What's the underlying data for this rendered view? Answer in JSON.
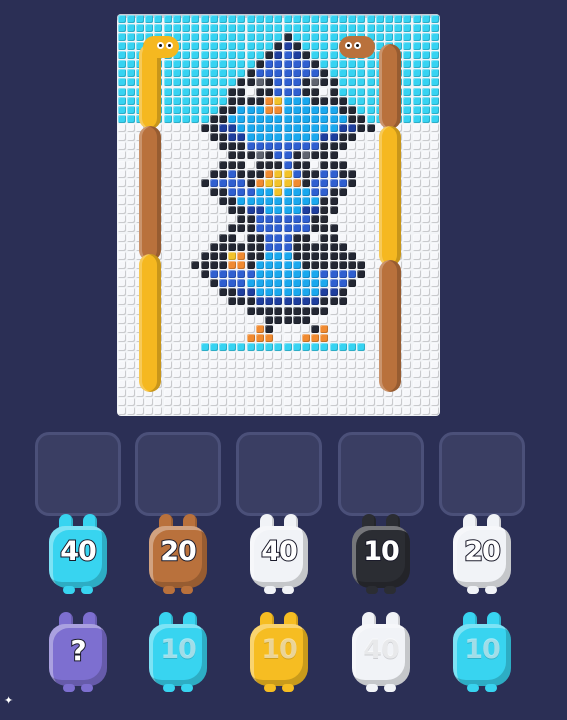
{
  "board": {
    "palette": {
      "W": "#f6f7fa",
      "C": "#36d3f2",
      "K": "#232733",
      "G": "#5f6470",
      "B": "#2f5fd0",
      "D": "#1e3e9e",
      "L": "#1aa8ee",
      "Y": "#f2c22a",
      "O": "#f08a30",
      "T": "#b88a5c"
    },
    "rows": [
      "CCCCCCCCCCCCCCCCCCCCCCCCCCCCCCCCCCC",
      "CCCCCCCCCCCCCCCCCCCCCCCCCCCCCCCCCCC",
      "CCCCCCCCCCCCCCCCCCKCCCCCCCCCCCCCCCC",
      "CCCCCCCCCCCCCCCCCKDKCCCCCCCCCCCCCCC",
      "CCCCCCCCCCCCCCCCKDBDKCCCCCCCCCCCCCC",
      "CCCCCCCCCCCCCCCKBBBBBKCCCCCCCCCCCCC",
      "CCCCCCCCCCCCCCKBBBBBBBKCCCCCCCCCCCC",
      "CCCCCCCCCCCCCKKGKBBBKGKKCCCCCCCCCCC",
      "CCCCCCCCCCCCKKWKKBBBKKWKCCCCCCCCCCC",
      "CCCCCCCCCCCCKKKKOYLLLKKKKCCCCCCCCCC",
      "CCCCCCCCCCCKKLLLOOLLLLLLKKCCCCCCCCC",
      "CCCCCCCCCCKKLLLLLLLLLLLLLKKCCCCCCCC",
      "WWWWWWWWWKKDDLLLLLLLLLLLDDKKWWWWWWW",
      "WWWWWWWWWWKKDDLLLLLLLLDDKKWWWWWWWWW",
      "WWWWWWWWWWWKKKBBBBBBBBKKKWWWWWWWWWW",
      "WWWWWWWWWWWWKKKGKBBKGKKKWWWWWWWWWWW",
      "WWWWWWWWWWWKKKWKKKBKKWKKKWWWWWWWWWW",
      "WWWWWWWWWWKKBKKKOYYBKKBBKKWWWWWWWWW",
      "WWWWWWWWWKBBBBKOYYYOKBBBBKWWWWWWWWW",
      "WWWWWWWWWWKKBBBLLYLLLBBKKWWWWWWWWWW",
      "WWWWWWWWWWWKKLLLLLLLLLKKWWWWWWWWWWW",
      "WWWWWWWWWWWWKKDDLLLLDDKKWWWWWWWWWWW",
      "WWWWWWWWWWWWWKKBBBBBBKKWWWWWWWWWWWW",
      "WWWWWWWWWWWWKKKBBBBBBKKKWWWWWWWWWWW",
      "WWWWWWWWWWWKKWKKBBBKKWKKWWWWWWWWWWW",
      "WWWWWWWWWWKKKKKKBBBKKKKKKWWWWWWWWWW",
      "WWWWWWWWWKKKYOKKLLLKKKKKKKWWWWWWWWW",
      "WWWWWWWWKKKKOOKLLLLLKKKKKKKWWWWWWWW",
      "WWWWWWWWWKBBBBBLLLLLLLBBBBKWWWWWWWW",
      "WWWWWWWWWWKBBBLLLLLLLLLBBKWWWWWWWWW",
      "WWWWWWWWWWWKKDDLLLLLLLDDKWWWWWWWWWW",
      "WWWWWWWWWWWWKKKDDDDDDDKKKWWWWWWWWWW",
      "WWWWWWWWWWWWWWKKKKKKKKKWWWWWWWWWWWW",
      "WWWWWWWWWWWWWWWWKKKKKWWWWWWWWWWWWWW",
      "WWWWWWWWWWWWWWWOKWWWWKOWWWWWWWWWWWW",
      "WWWWWWWWWWWWWWOOOWWWOOOWWWWWWWWWWWW",
      "WWWWWWWWWCCCCCCCCCCCCCCCCCCWWWWWWWW",
      "WWWWWWWWWWWWWWWWWWWWWWWWWWWWWWWWWWW",
      "WWWWWWWWWWWWWWWWWWWWWWWWWWWWWWWWWWW",
      "WWWWWWWWWWWWWWWWWWWWWWWWWWWWWWWWWWW",
      "WWWWWWWWWWWWWWWWWWWWWWWWWWWWWWWWWWW",
      "WWWWWWWWWWWWWWWWWWWWWWWWWWWWWWWWWWW",
      "WWWWWWWWWWWWWWWWWWWWWWWWWWWWWWWWWWW",
      "WWWWWWWWWWWWWWWWWWWWWWWWWWWWWWWWWWW"
    ]
  },
  "snakes": [
    {
      "name": "yellow-snake-left",
      "color": "#f5b820"
    },
    {
      "name": "brown-snake-left",
      "color": "#b9713c"
    },
    {
      "name": "brown-snake-right",
      "color": "#b9713c"
    },
    {
      "name": "yellow-snake-right",
      "color": "#f5b820"
    }
  ],
  "slots": [
    {
      "label": ""
    },
    {
      "label": ""
    },
    {
      "label": ""
    },
    {
      "label": ""
    },
    {
      "label": ""
    }
  ],
  "pets": {
    "row1": [
      {
        "count": "40",
        "color": "#38d4f0",
        "icon": "cyan-pet-icon"
      },
      {
        "count": "20",
        "color": "#b9713c",
        "icon": "brown-pet-icon"
      },
      {
        "count": "40",
        "color": "#f1f3f7",
        "icon": "white-pet-icon"
      },
      {
        "count": "10",
        "color": "#2b2d33",
        "icon": "black-pet-icon"
      },
      {
        "count": "20",
        "color": "#f1f3f7",
        "icon": "white-pet-icon"
      }
    ],
    "row2": [
      {
        "count": "?",
        "color": "#7d6fd0",
        "icon": "mystery-pet-icon"
      },
      {
        "count": "10",
        "color": "#38d4f0",
        "icon": "cyan-pet-icon"
      },
      {
        "count": "10",
        "color": "#f6bd22",
        "icon": "yellow-pet-icon"
      },
      {
        "count": "40",
        "color": "#f1f3f7",
        "icon": "white-pet-icon"
      },
      {
        "count": "10",
        "color": "#38d4f0",
        "icon": "cyan-pet-icon"
      }
    ]
  }
}
